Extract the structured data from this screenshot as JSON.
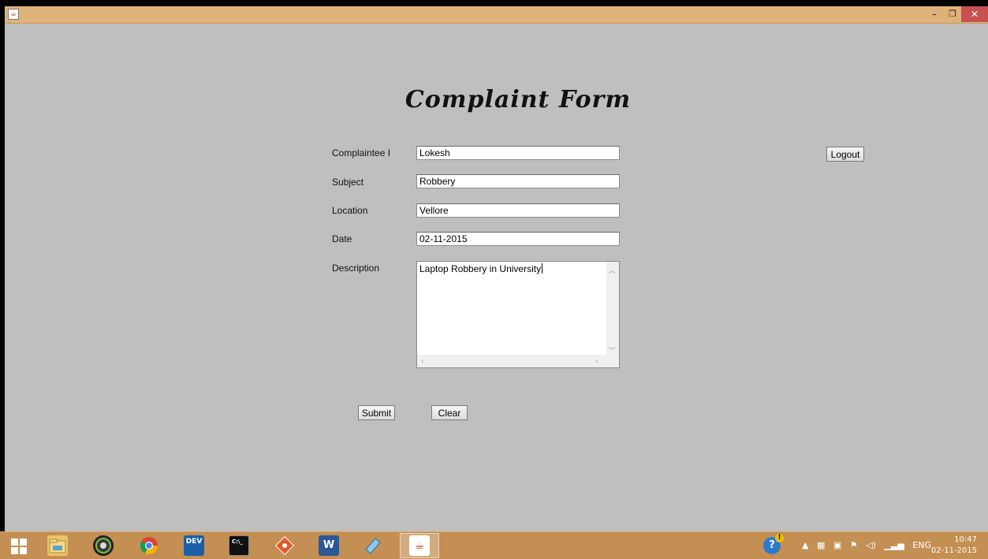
{
  "window": {
    "minimize_glyph": "–",
    "maximize_glyph": "❐",
    "close_glyph": "✕"
  },
  "form": {
    "title": "Complaint Form",
    "fields": {
      "complaintee": {
        "label": "Complaintee I",
        "value": "Lokesh"
      },
      "subject": {
        "label": "Subject",
        "value": "Robbery"
      },
      "location": {
        "label": "Location",
        "value": "Vellore"
      },
      "date": {
        "label": "Date",
        "value": "02-11-2015"
      },
      "description": {
        "label": "Description",
        "value": "Laptop Robbery in University"
      }
    },
    "buttons": {
      "logout": "Logout",
      "submit": "Submit",
      "clear": "Clear"
    }
  },
  "taskbar": {
    "apps": [
      "file-explorer-icon",
      "camera-icon",
      "chrome-icon",
      "dev-cpp-icon",
      "command-prompt-icon",
      "git-icon",
      "word-icon",
      "notepad-icon",
      "java-icon"
    ],
    "dev_label": "DEV",
    "cmd_label": "C:\\_",
    "word_label": "W",
    "tray": {
      "language": "ENG",
      "time": "10:47",
      "date": "02-11-2015"
    }
  },
  "colors": {
    "title_bar": "#dfb27a",
    "form_background": "#bfbfbf",
    "taskbar": "#c48f52",
    "close_button": "#c75050"
  }
}
